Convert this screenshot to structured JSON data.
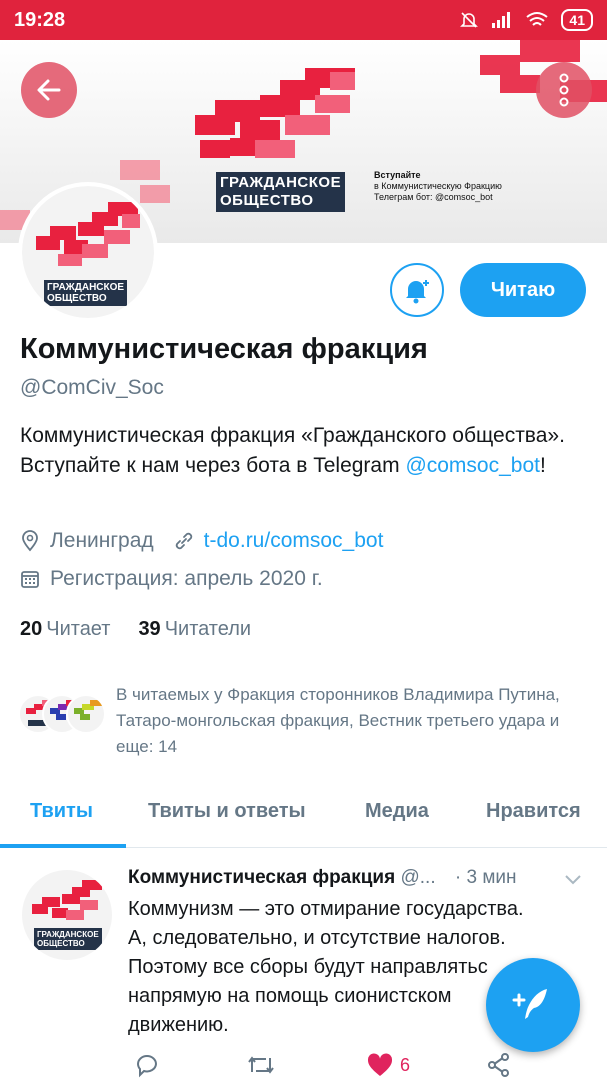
{
  "status_bar": {
    "time": "19:28",
    "battery": "41"
  },
  "banner": {
    "logo_line1": "ГРАЖДАНСКОЕ",
    "logo_line2": "ОБЩЕСТВО",
    "note_line1": "Вступайте",
    "note_line2": "в Коммунистическую Фракцию",
    "note_line3": "Телеграм бот: @comsoc_bot"
  },
  "avatar": {
    "logo_line1": "ГРАЖДАНСКОЕ",
    "logo_line2": "ОБЩЕСТВО"
  },
  "actions": {
    "follow_label": "Читаю"
  },
  "profile": {
    "name": "Коммунистическая фракция",
    "handle": "@ComCiv_Soc",
    "bio_text": "Коммунистическая фракция «Гражданского общества». Вступайте к нам через бота в Telegram ",
    "bio_link": "@comsoc_bot",
    "bio_end": "!",
    "location": "Ленинград",
    "website": "t-do.ru/comsoc_bot",
    "joined": "Регистрация: апрель 2020 г.",
    "following_count": "20",
    "following_label": "Читает",
    "followers_count": "39",
    "followers_label": "Читатели"
  },
  "followed_by": {
    "text": "В читаемых у Фракция сторонников Владимира Путина, Татаро-монгольская фракция, Вестник третьего удара и еще: 14"
  },
  "tabs": [
    {
      "label": "Твиты"
    },
    {
      "label": "Твиты и ответы"
    },
    {
      "label": "Медиа"
    },
    {
      "label": "Нравится"
    }
  ],
  "tweet": {
    "author": "Коммунистическая фракция",
    "handle": "@...",
    "time": "· 3 мин",
    "text": "Коммунизм — это отмирание государства. А, следовательно, и отсутствие налогов. Поэтому все сборы будут направлятьс напрямую на помощь сионистском движению.",
    "like_count": "6"
  },
  "colors": {
    "accent": "#1da1f2",
    "status_bar": "#e0233d",
    "like": "#e0245e"
  }
}
